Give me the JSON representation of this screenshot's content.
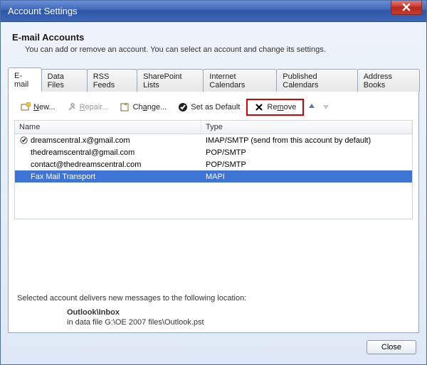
{
  "window": {
    "title": "Account Settings"
  },
  "header": {
    "title": "E-mail Accounts",
    "subtitle": "You can add or remove an account. You can select an account and change its settings."
  },
  "tabs": [
    {
      "label": "E-mail",
      "active": true
    },
    {
      "label": "Data Files"
    },
    {
      "label": "RSS Feeds"
    },
    {
      "label": "SharePoint Lists"
    },
    {
      "label": "Internet Calendars"
    },
    {
      "label": "Published Calendars"
    },
    {
      "label": "Address Books"
    }
  ],
  "toolbar": {
    "new": "New...",
    "repair": "Repair...",
    "change": "Change...",
    "setdefault": "Set as Default",
    "remove": "Remove"
  },
  "columns": {
    "name": "Name",
    "type": "Type"
  },
  "accounts": [
    {
      "name": "dreamscentral.x@gmail.com",
      "type": "IMAP/SMTP (send from this account by default)",
      "default": true,
      "selected": false
    },
    {
      "name": "thedreamscentral@gmail.com",
      "type": "POP/SMTP",
      "default": false,
      "selected": false
    },
    {
      "name": "contact@thedreamscentral.com",
      "type": "POP/SMTP",
      "default": false,
      "selected": false
    },
    {
      "name": "Fax Mail Transport",
      "type": "MAPI",
      "default": false,
      "selected": true
    }
  ],
  "delivery": {
    "intro": "Selected account delivers new messages to the following location:",
    "folder": "Outlook\\Inbox",
    "path_prefix": "in data file ",
    "path": "G:\\OE 2007 files\\Outlook.pst"
  },
  "buttons": {
    "close": "Close"
  }
}
